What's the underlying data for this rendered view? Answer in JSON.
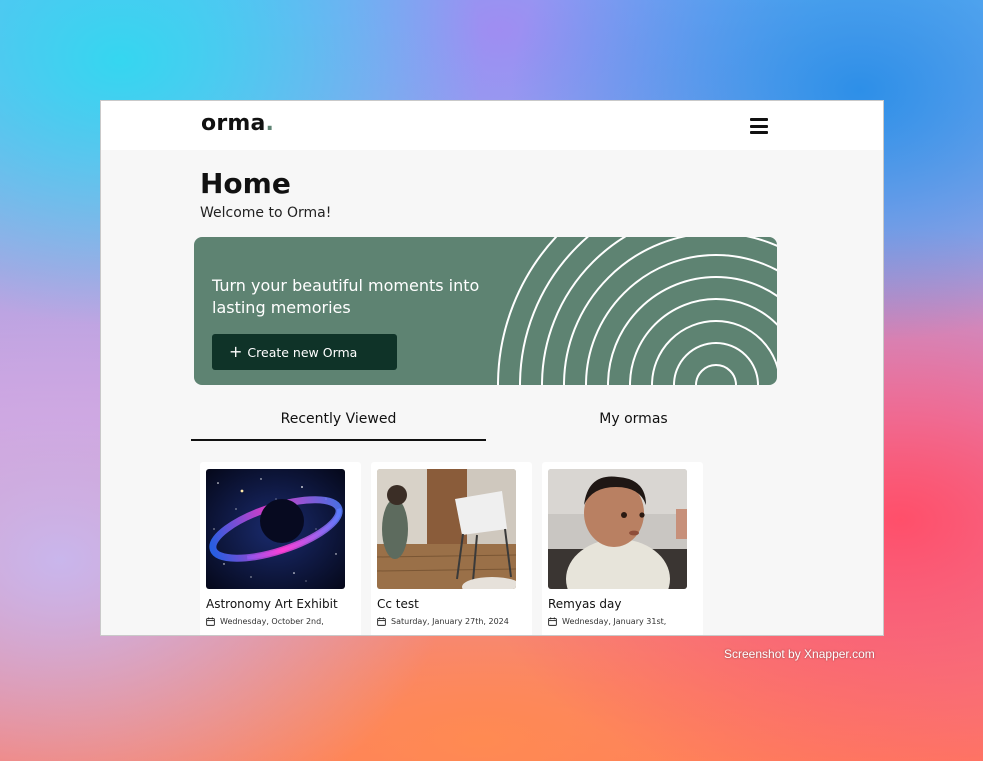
{
  "app": {
    "logo_text": "orma",
    "logo_dot": ".",
    "menu_icon": "hamburger-menu-icon"
  },
  "page": {
    "title": "Home",
    "subtitle": "Welcome to Orma!"
  },
  "hero": {
    "headline": "Turn your beautiful moments into lasting memories",
    "button_icon": "+",
    "button_label": "Create new Orma",
    "background_color": "#5e8372",
    "button_color": "#0f3328"
  },
  "tabs": [
    {
      "label": "Recently Viewed",
      "active": true
    },
    {
      "label": "My ormas",
      "active": false
    }
  ],
  "cards": [
    {
      "title": "Astronomy Art Exhibit",
      "date": "Wednesday, October 2nd,",
      "thumb": "galaxy-image"
    },
    {
      "title": "Cc test",
      "date": "Saturday, January 27th, 2024",
      "thumb": "room-photo"
    },
    {
      "title": "Remyas day",
      "date": "Wednesday, January 31st,",
      "thumb": "baby-photo"
    }
  ],
  "watermark": "Screenshot by Xnapper.com"
}
